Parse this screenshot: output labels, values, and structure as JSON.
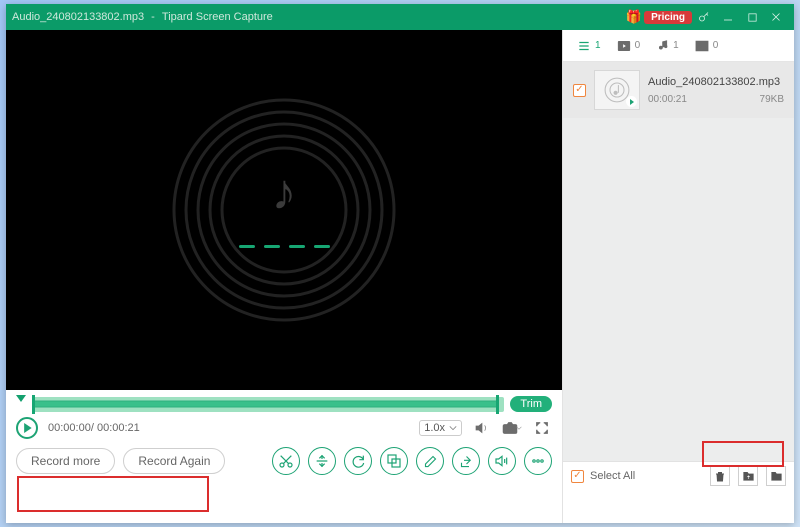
{
  "header": {
    "file_name": "Audio_240802133802.mp3",
    "app_name": "Tipard Screen Capture",
    "pricing_label": "Pricing"
  },
  "player": {
    "current_time": "00:00:00",
    "total_time": "00:00:21",
    "speed_label": "1.0x",
    "trim_label": "Trim"
  },
  "actions": {
    "record_more": "Record more",
    "record_again": "Record Again"
  },
  "panel": {
    "counts": {
      "list": "1",
      "video": "0",
      "audio": "1",
      "image": "0"
    },
    "select_all_label": "Select All",
    "items": [
      {
        "name": "Audio_240802133802.mp3",
        "duration": "00:00:21",
        "size": "79KB"
      }
    ]
  }
}
